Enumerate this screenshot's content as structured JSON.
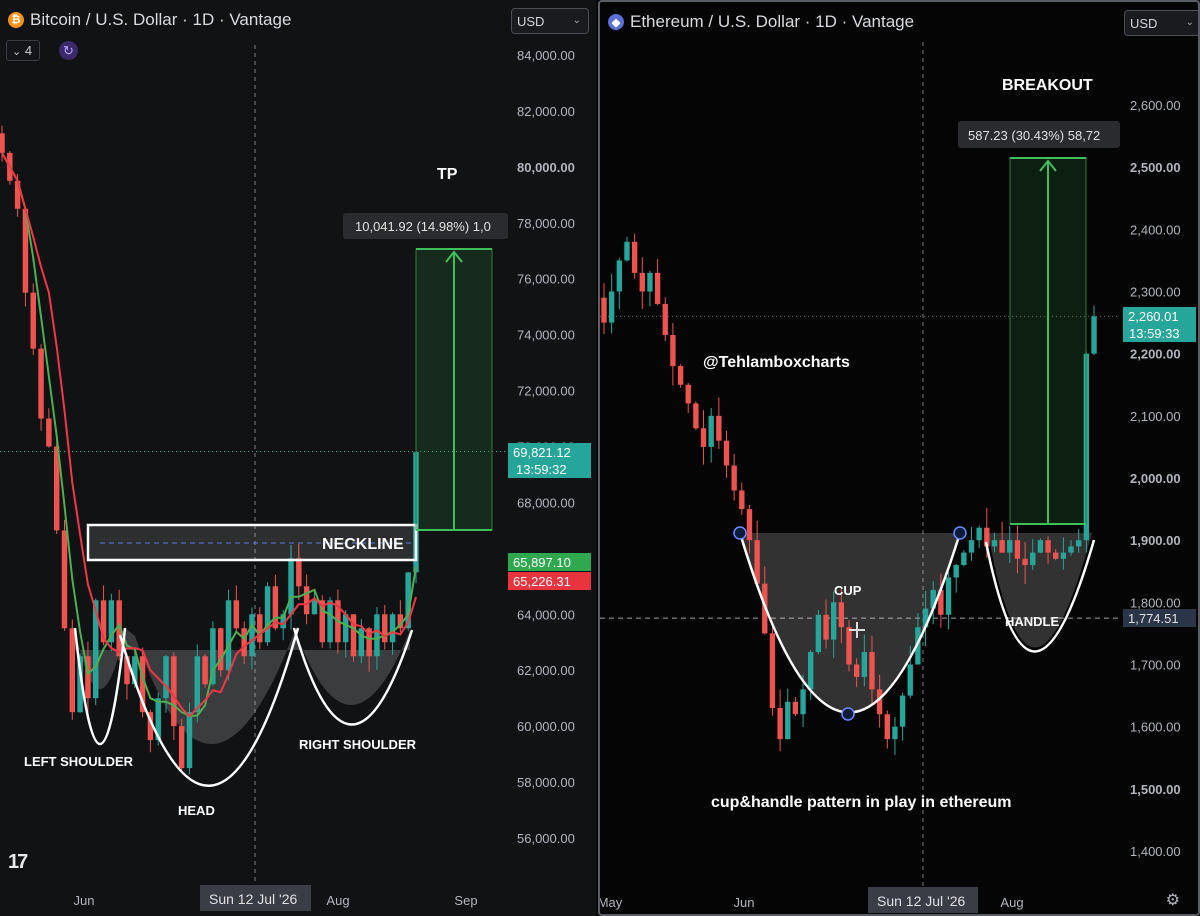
{
  "btc": {
    "title": "Bitcoin / U.S. Dollar · 1D · Vantage",
    "currency": "USD",
    "indicator_count": "4",
    "price_ticks": [
      "84,000.00",
      "82,000.00",
      "80,000.00",
      "78,000.00",
      "76,000.00",
      "74,000.00",
      "72,000.00",
      "70,000.00",
      "68,000.00",
      "66,000.00",
      "64,000.00",
      "62,000.00",
      "60,000.00",
      "58,000.00",
      "56,000.00"
    ],
    "price_tick_values": [
      84000,
      82000,
      80000,
      78000,
      76000,
      74000,
      72000,
      70000,
      68000,
      66000,
      64000,
      62000,
      60000,
      58000,
      56000
    ],
    "time_ticks": [
      "Jun",
      "Aug",
      "Sep"
    ],
    "crosshair_date": "Sun 12 Jul '26",
    "last_price": "69,821.12",
    "countdown": "13:59:32",
    "ma_green": "65,897.10",
    "ma_red": "65,226.31",
    "measure_label": "10,041.92 (14.98%) 1,0",
    "annotations": {
      "tp": "TP",
      "neckline": "NECKLINE",
      "left_shoulder": "LEFT SHOULDER",
      "head": "HEAD",
      "right_shoulder": "RIGHT SHOULDER"
    }
  },
  "eth": {
    "title": "Ethereum / U.S. Dollar · 1D · Vantage",
    "currency": "USD",
    "price_ticks": [
      "2,600.00",
      "2,500.00",
      "2,400.00",
      "2,300.00",
      "2,200.00",
      "2,100.00",
      "2,000.00",
      "1,900.00",
      "1,800.00",
      "1,700.00",
      "1,600.00",
      "1,500.00",
      "1,400.00"
    ],
    "price_tick_values": [
      2600,
      2500,
      2400,
      2300,
      2200,
      2100,
      2000,
      1900,
      1800,
      1700,
      1600,
      1500,
      1400
    ],
    "time_ticks": [
      "May",
      "Jun",
      "Aug"
    ],
    "crosshair_date": "Sun 12 Jul '26",
    "last_price": "2,260.01",
    "countdown": "13:59:33",
    "crosshair_price": "1,774.51",
    "measure_label": "587.23 (30.43%) 58,72",
    "annotations": {
      "breakout": "BREAKOUT",
      "handle_author": "@Tehlamboxcharts",
      "cup": "CUP",
      "handle": "HANDLE",
      "caption": "cup&handle pattern in play in ethereum"
    }
  },
  "colors": {
    "up": "#26a69a",
    "down": "#ef5350",
    "ma_green": "#4caf50",
    "ma_red": "#f23645",
    "target": "#3fbf5a",
    "panel_bg": "#111214"
  },
  "chart_data": [
    {
      "type": "candlestick",
      "title": "Bitcoin / U.S. Dollar · 1D · Vantage",
      "ylim": [
        55000,
        85500
      ],
      "x": [
        "Jun",
        "Aug",
        "Sep"
      ],
      "series": [
        {
          "name": "",
          "values": [
            80500,
            79500,
            78500,
            75500,
            73500,
            71000,
            70000,
            67000,
            63500,
            60500,
            62500,
            61000,
            64500,
            63000,
            64500,
            62500,
            61500,
            62500,
            60500,
            59500,
            61000,
            62500,
            60000,
            58500,
            60500,
            62500,
            61500,
            63500,
            62000,
            64500,
            63500,
            62500,
            64000,
            63000,
            65000,
            63500,
            64000,
            66000,
            65000,
            64000,
            64500,
            63000,
            64500,
            63000,
            64000,
            62500,
            63500,
            62500,
            64000,
            63000,
            64000,
            63500,
            65500,
            69800
          ]
        }
      ],
      "neckline": 65900,
      "target": [
        66800,
        76900
      ]
    },
    {
      "type": "candlestick",
      "title": "Ethereum / U.S. Dollar · 1D · Vantage",
      "ylim": [
        1380,
        2680
      ],
      "x": [
        "May",
        "Jun",
        "Aug"
      ],
      "series": [
        {
          "name": "",
          "values": [
            2250,
            2300,
            2350,
            2380,
            2330,
            2300,
            2330,
            2280,
            2230,
            2180,
            2150,
            2120,
            2080,
            2050,
            2100,
            2060,
            2020,
            1980,
            1950,
            1900,
            1830,
            1750,
            1630,
            1580,
            1640,
            1620,
            1660,
            1720,
            1780,
            1740,
            1800,
            1760,
            1700,
            1680,
            1720,
            1660,
            1620,
            1580,
            1600,
            1650,
            1700,
            1760,
            1790,
            1820,
            1780,
            1840,
            1860,
            1880,
            1900,
            1920,
            1890,
            1900,
            1880,
            1900,
            1870,
            1860,
            1880,
            1900,
            1880,
            1870,
            1880,
            1890,
            1900,
            2200,
            2260
          ]
        }
      ],
      "cup_rim": 1910,
      "target": [
        1927,
        2515
      ]
    }
  ]
}
